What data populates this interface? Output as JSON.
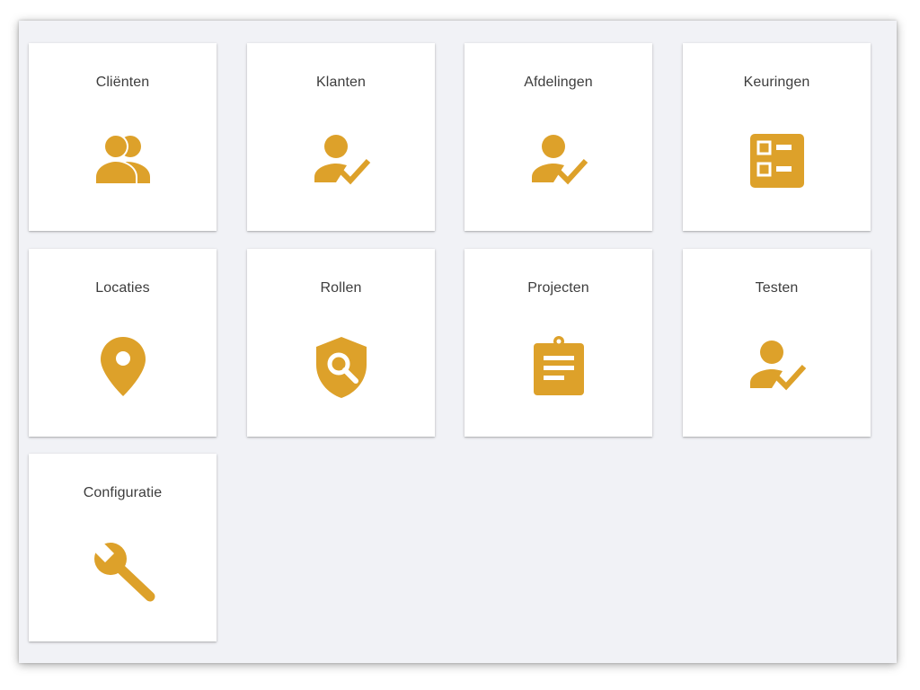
{
  "theme": {
    "accent": "#dda12a",
    "background": "#f1f2f6",
    "tile_background": "#ffffff",
    "label_color": "#3d3d3d"
  },
  "tiles": [
    {
      "label": "Cliënten",
      "icon": "group-icon"
    },
    {
      "label": "Klanten",
      "icon": "person-check-icon"
    },
    {
      "label": "Afdelingen",
      "icon": "person-check-icon"
    },
    {
      "label": "Keuringen",
      "icon": "checklist-icon"
    },
    {
      "label": "Locaties",
      "icon": "location-pin-icon"
    },
    {
      "label": "Rollen",
      "icon": "shield-search-icon"
    },
    {
      "label": "Projecten",
      "icon": "clipboard-icon"
    },
    {
      "label": "Testen",
      "icon": "person-check-icon"
    },
    {
      "label": "Configuratie",
      "icon": "wrench-icon"
    }
  ]
}
